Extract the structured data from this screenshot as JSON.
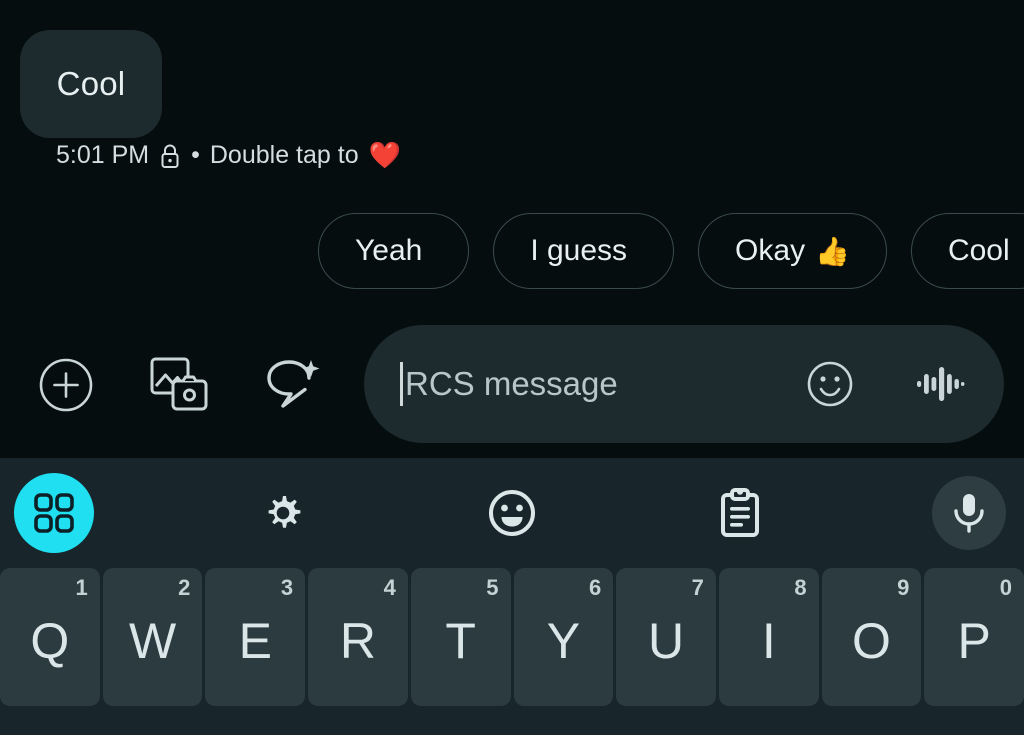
{
  "conversation": {
    "incoming_message": {
      "text": "Cool",
      "timestamp": "5:01 PM",
      "encryption_icon": "lock-icon",
      "separator": "•",
      "reaction_hint": "Double tap to",
      "reaction_emoji": "❤️"
    }
  },
  "suggestions": {
    "chips": [
      {
        "label": "Yeah",
        "emoji": ""
      },
      {
        "label": "I guess",
        "emoji": ""
      },
      {
        "label": "Okay",
        "emoji": "👍"
      },
      {
        "label": "Cool",
        "emoji": ""
      }
    ]
  },
  "compose": {
    "attach_icon": "plus-circle-icon",
    "gallery_icon": "gallery-camera-icon",
    "magic_icon": "magic-reply-icon",
    "input": {
      "value": "",
      "placeholder": "RCS message"
    },
    "emoji_icon": "emoji-smiley-icon",
    "voice_icon": "voice-waveform-icon"
  },
  "keyboard": {
    "toolbar": {
      "grid_icon": "app-grid-icon",
      "grid_accent_color": "#20dff0",
      "settings_icon": "gear-icon",
      "emoji_icon": "emoji-face-icon",
      "clipboard_icon": "clipboard-icon",
      "mic_icon": "microphone-icon"
    },
    "row1": [
      {
        "letter": "Q",
        "num": "1"
      },
      {
        "letter": "W",
        "num": "2"
      },
      {
        "letter": "E",
        "num": "3"
      },
      {
        "letter": "R",
        "num": "4"
      },
      {
        "letter": "T",
        "num": "5"
      },
      {
        "letter": "Y",
        "num": "6"
      },
      {
        "letter": "U",
        "num": "7"
      },
      {
        "letter": "I",
        "num": "8"
      },
      {
        "letter": "O",
        "num": "9"
      },
      {
        "letter": "P",
        "num": "0"
      }
    ]
  },
  "colors": {
    "background": "#050d0e",
    "bubble": "#1d2b2e",
    "keyboard_bg": "#18252a",
    "key_bg": "#2c3b40",
    "accent_cyan": "#20dff0",
    "heart_red": "#f0463c"
  }
}
